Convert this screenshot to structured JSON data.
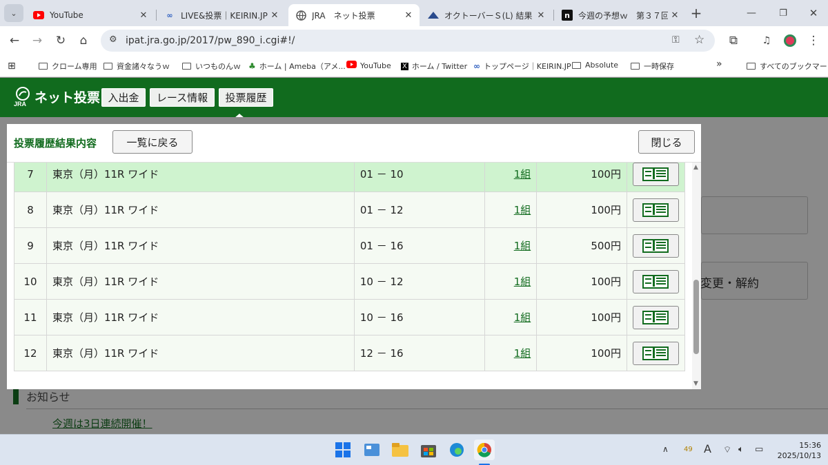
{
  "browser": {
    "tabs": [
      {
        "title": "YouTube",
        "icon": "youtube-icon",
        "active": false
      },
      {
        "title": "LIVE&投票｜KEIRIN.JP",
        "icon": "keirin-icon",
        "active": false
      },
      {
        "title": "JRA　ネット投票",
        "icon": "globe-icon",
        "active": true
      },
      {
        "title": "オクトーバーＳ(L) 結果・払戻",
        "icon": "netkeiba-icon",
        "active": false
      },
      {
        "title": "今週の予想ｗ　第３７回",
        "icon": "note-icon",
        "active": false
      }
    ],
    "url": "ipat.jra.go.jp/2017/pw_890_i.cgi#!/",
    "bookmarks": [
      {
        "label": "クローム専用",
        "icon": "folder-icon"
      },
      {
        "label": "資金諸々なうｗ",
        "icon": "folder-icon"
      },
      {
        "label": "いつものんｗ",
        "icon": "folder-icon"
      },
      {
        "label": "ホーム | Ameba（アメ...",
        "icon": "ameba-icon"
      },
      {
        "label": "YouTube",
        "icon": "youtube-icon"
      },
      {
        "label": "ホーム / Twitter",
        "icon": "x-icon"
      },
      {
        "label": "トップページ｜KEIRIN.JP",
        "icon": "keirin-icon"
      },
      {
        "label": "Absolute",
        "icon": "folder-icon"
      },
      {
        "label": "一時保存",
        "icon": "folder-icon"
      }
    ],
    "all_bookmarks": "すべてのブックマーク",
    "overflow": "»"
  },
  "header": {
    "logo_text": "ネット投票",
    "logo_sub": "JRA",
    "buttons": [
      "入出金",
      "レース情報",
      "投票履歴"
    ]
  },
  "background": {
    "change_label": "変更・解約",
    "notice_title": "お知らせ",
    "notice_link": "今週は3日連続開催！"
  },
  "modal": {
    "title": "投票履歴結果内容",
    "back_label": "一覧に戻る",
    "close_label": "閉じる",
    "rows": [
      {
        "no": "7",
        "race": "東京（月）11R ワイド",
        "combo": "01 － 10",
        "count": "1組",
        "amount": "100円",
        "highlight": true
      },
      {
        "no": "8",
        "race": "東京（月）11R ワイド",
        "combo": "01 － 12",
        "count": "1組",
        "amount": "100円",
        "highlight": false
      },
      {
        "no": "9",
        "race": "東京（月）11R ワイド",
        "combo": "01 － 16",
        "count": "1組",
        "amount": "500円",
        "highlight": false
      },
      {
        "no": "10",
        "race": "東京（月）11R ワイド",
        "combo": "10 － 12",
        "count": "1組",
        "amount": "100円",
        "highlight": false
      },
      {
        "no": "11",
        "race": "東京（月）11R ワイド",
        "combo": "10 － 16",
        "count": "1組",
        "amount": "100円",
        "highlight": false
      },
      {
        "no": "12",
        "race": "東京（月）11R ワイド",
        "combo": "12 － 16",
        "count": "1組",
        "amount": "100円",
        "highlight": false
      }
    ]
  },
  "taskbar": {
    "time": "15:36",
    "date": "2025/10/13",
    "notif_count": "49",
    "ime": "A"
  },
  "colors": {
    "jra_green": "#116b1e",
    "row_highlight": "#cff3cf",
    "row_normal": "#f5faf3"
  }
}
